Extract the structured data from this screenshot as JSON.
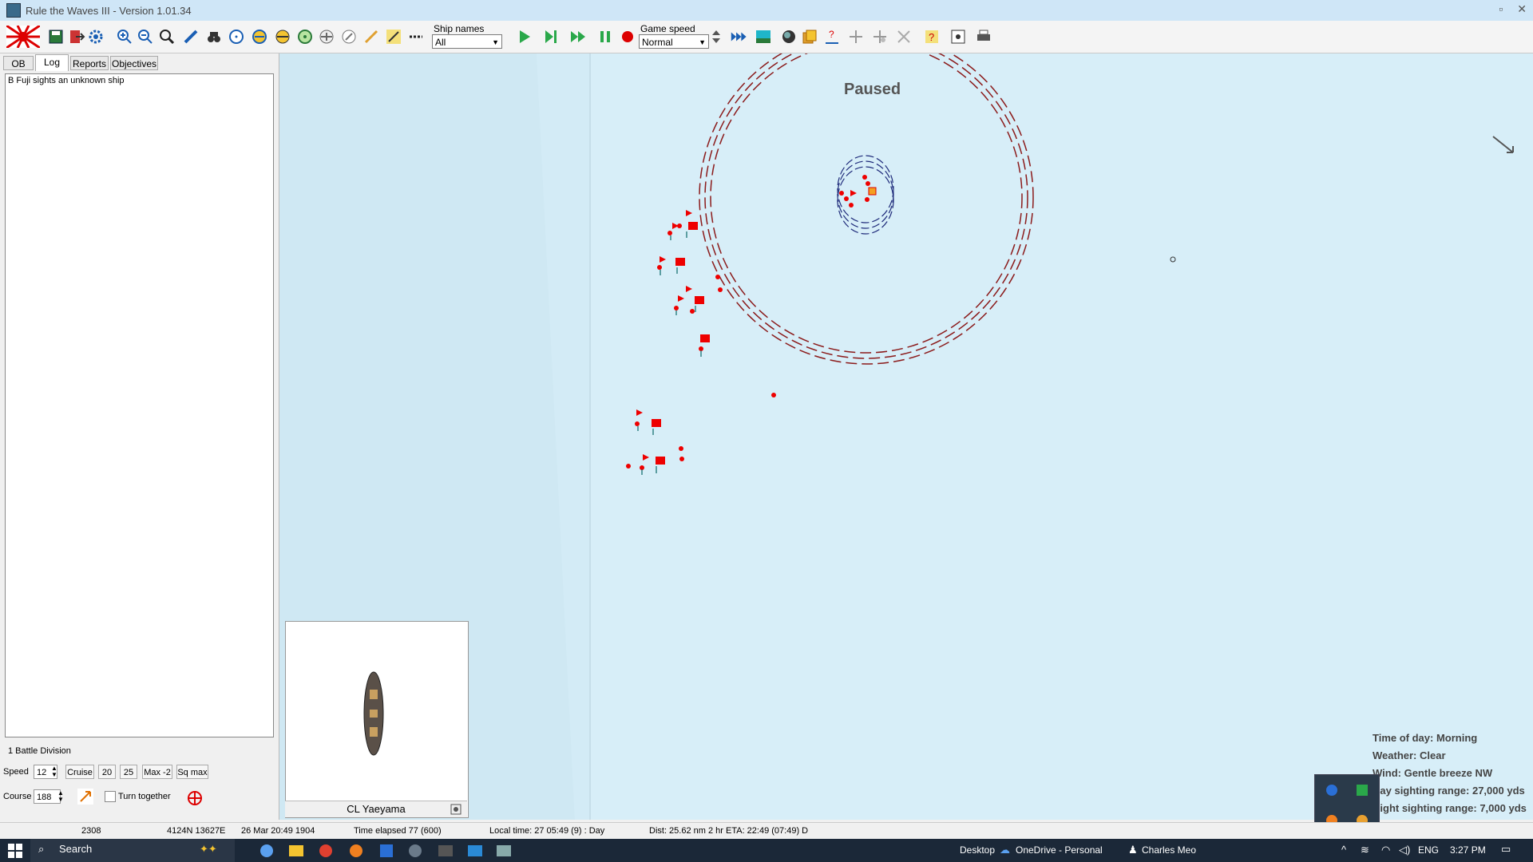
{
  "window": {
    "title": "Rule the Waves III - Version 1.01.34"
  },
  "toolbar": {
    "ship_names_label": "Ship names",
    "ship_names_value": "All",
    "game_speed_label": "Game speed",
    "game_speed_value": "Normal"
  },
  "tabs": [
    "OB",
    "Log",
    "Reports",
    "Objectives"
  ],
  "log": {
    "entries": [
      "B Fuji sights an unknown ship"
    ]
  },
  "division": {
    "name": "1 Battle Division"
  },
  "controls": {
    "speed_label": "Speed",
    "speed_value": "12",
    "cruise_label": "Cruise",
    "speed_20": "20",
    "speed_25": "25",
    "max2_label": "Max -2",
    "sqmax_label": "Sq max",
    "course_label": "Course",
    "course_value": "188",
    "turn_together_label": "Turn together"
  },
  "ship_panel": {
    "ship_name": "CL Yaeyama"
  },
  "map": {
    "paused_label": "Paused",
    "info": {
      "time_of_day": "Time of day: Morning",
      "weather": "Weather: Clear",
      "wind": "Wind: Gentle breeze  NW",
      "day_range": "Day sighting range: 27,000 yds",
      "night_range": "Night sighting range: 7,000 yds"
    }
  },
  "statusbar": {
    "id": "2308",
    "position": "4124N 13627E",
    "date": "26 Mar 20:49 1904",
    "time_elapsed": "Time elapsed 77 (600)",
    "local_time": "Local time: 27 05:49 (9) : Day",
    "dist": "Dist: 25.62 nm 2 hr ETA: 22:49 (07:49) D"
  },
  "taskbar": {
    "search_placeholder": "Search",
    "desktop_label": "Desktop",
    "onedrive_label": "OneDrive - Personal",
    "user_label": "Charles Meo",
    "lang": "ENG",
    "clock": "3:27 PM"
  },
  "colors": {
    "map_sea": "#d7eef8",
    "ship_marker": "#e00000",
    "range_ring": "#8b1a1a",
    "sonar_ring": "#1e2a7a"
  }
}
